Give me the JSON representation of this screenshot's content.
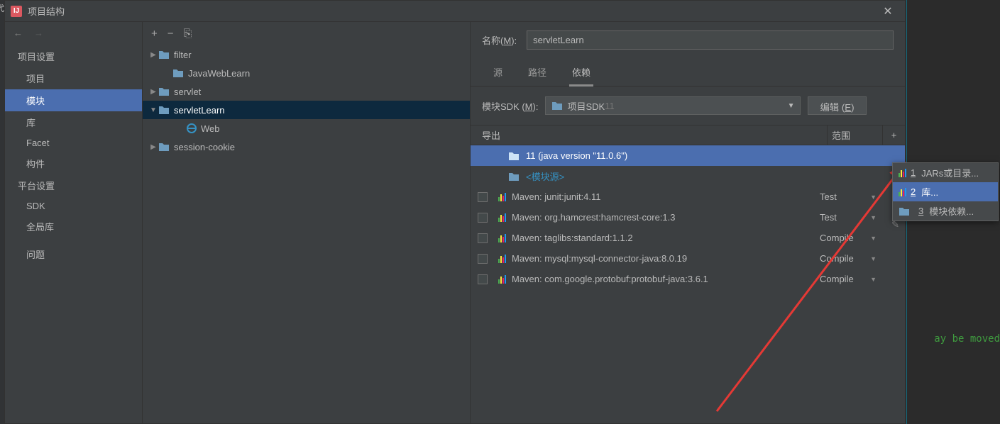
{
  "titlebar": {
    "title": "项目结构"
  },
  "sidebar": {
    "nav_back": "←",
    "nav_fwd": "→",
    "heading1": "项目设置",
    "items1": [
      "项目",
      "模块",
      "库",
      "Facet",
      "构件"
    ],
    "heading2": "平台设置",
    "items2": [
      "SDK",
      "全局库"
    ],
    "heading3": "问题"
  },
  "tree_toolbar": {
    "add": "+",
    "remove": "−",
    "copy": "⎘"
  },
  "tree": [
    {
      "arrow": "▶",
      "depth": 0,
      "label": "filter",
      "type": "folder"
    },
    {
      "arrow": "",
      "depth": 1,
      "label": "JavaWebLearn",
      "type": "folder"
    },
    {
      "arrow": "▶",
      "depth": 0,
      "label": "servlet",
      "type": "folder"
    },
    {
      "arrow": "▼",
      "depth": 0,
      "label": "servletLearn",
      "type": "folder",
      "selected": true
    },
    {
      "arrow": "",
      "depth": 2,
      "label": "Web",
      "type": "web"
    },
    {
      "arrow": "▶",
      "depth": 0,
      "label": "session-cookie",
      "type": "folder"
    }
  ],
  "name_field": {
    "label": "名称(",
    "mn": "M",
    "label2": "):",
    "value": "servletLearn"
  },
  "tabs": [
    "源",
    "路径",
    "依赖"
  ],
  "sdk_row": {
    "label": "模块SDK (",
    "mn": "M",
    "label2": "):",
    "value": "项目SDK ",
    "value_dim": "11",
    "edit": "编辑 (",
    "edit_mn": "E",
    "edit2": ")"
  },
  "dep_head": {
    "export": "导出",
    "scope": "范围",
    "add": "+"
  },
  "deps": [
    {
      "checkbox": false,
      "icon": "folder",
      "text": "11 (java version \"11.0.6\")",
      "scope": "",
      "selected": true,
      "indent": 1
    },
    {
      "checkbox": false,
      "icon": "folder",
      "text": "<模块源>",
      "scope": "",
      "source": true,
      "indent": 1
    },
    {
      "checkbox": true,
      "icon": "lib",
      "text": "Maven: junit:junit:4.11",
      "scope": "Test"
    },
    {
      "checkbox": true,
      "icon": "lib",
      "text": "Maven: org.hamcrest:hamcrest-core:1.3",
      "scope": "Test"
    },
    {
      "checkbox": true,
      "icon": "lib",
      "text": "Maven: taglibs:standard:1.1.2",
      "scope": "Compile"
    },
    {
      "checkbox": true,
      "icon": "lib",
      "text": "Maven: mysql:mysql-connector-java:8.0.19",
      "scope": "Compile"
    },
    {
      "checkbox": true,
      "icon": "lib",
      "text": "Maven: com.google.protobuf:protobuf-java:3.6.1",
      "scope": "Compile"
    }
  ],
  "popup": [
    {
      "num": "1",
      "label": "JARs或目录...",
      "icon": "lib"
    },
    {
      "num": "2",
      "label": "库...",
      "icon": "lib",
      "selected": true
    },
    {
      "num": "3",
      "label": "模块依赖...",
      "icon": "folder"
    }
  ],
  "bg_text": "ay be moved",
  "left_edge": "代"
}
